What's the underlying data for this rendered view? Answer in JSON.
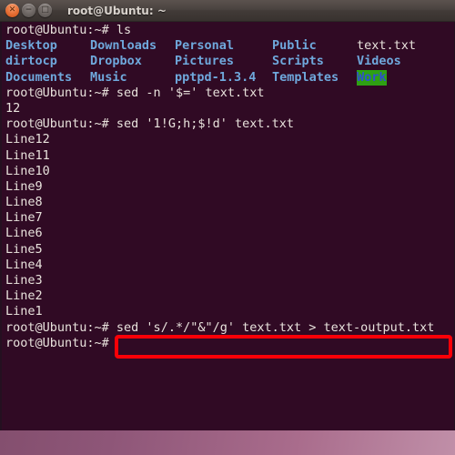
{
  "window": {
    "title": "root@Ubuntu: ~",
    "buttons": [
      {
        "name": "close",
        "glyph": "✕"
      },
      {
        "name": "minimize",
        "glyph": "−"
      },
      {
        "name": "maximize",
        "glyph": "□"
      }
    ]
  },
  "terminal": {
    "prompt": "root@Ubuntu:~# ",
    "colors": {
      "background": "#300a24",
      "foreground": "#e8e2dc",
      "directory_blue": "#6fa8dc",
      "other_writable_bg": "#2ea013",
      "annotation_red": "#fb0007"
    },
    "lines": [
      {
        "type": "command",
        "prompt": "root@Ubuntu:~# ",
        "command": "ls"
      }
    ],
    "ls_output": {
      "rows": [
        [
          {
            "text": "Desktop",
            "style": "blue"
          },
          {
            "text": "Downloads",
            "style": "blue"
          },
          {
            "text": "Personal",
            "style": "blue"
          },
          {
            "text": "Public",
            "style": "blue"
          },
          {
            "text": "text.txt",
            "style": "white"
          }
        ],
        [
          {
            "text": "dirtocp",
            "style": "blue"
          },
          {
            "text": "Dropbox",
            "style": "blue"
          },
          {
            "text": "Pictures",
            "style": "blue"
          },
          {
            "text": "Scripts",
            "style": "blue"
          },
          {
            "text": "Videos",
            "style": "blue"
          }
        ],
        [
          {
            "text": "Documents",
            "style": "blue"
          },
          {
            "text": "Music",
            "style": "blue"
          },
          {
            "text": "pptpd-1.3.4",
            "style": "blue"
          },
          {
            "text": "Templates",
            "style": "blue"
          },
          {
            "text": "Work",
            "style": "greenbg"
          }
        ]
      ]
    },
    "command_count": {
      "prompt": "root@Ubuntu:~# ",
      "command": "sed -n '$=' text.txt",
      "output": "12"
    },
    "command_reverse": {
      "prompt": "root@Ubuntu:~# ",
      "command": "sed '1!G;h;$!d' text.txt"
    },
    "reverse_output": [
      "Line12",
      "Line11",
      "Line10",
      "Line9",
      "Line8",
      "Line7",
      "Line6",
      "Line5",
      "Line4",
      "Line3",
      "Line2",
      "Line1"
    ],
    "command_highlighted": {
      "prompt": "root@Ubuntu:~# ",
      "command": "sed 's/.*/\"&\"/g' text.txt > text-output.txt"
    },
    "final_prompt": "root@Ubuntu:~# "
  }
}
